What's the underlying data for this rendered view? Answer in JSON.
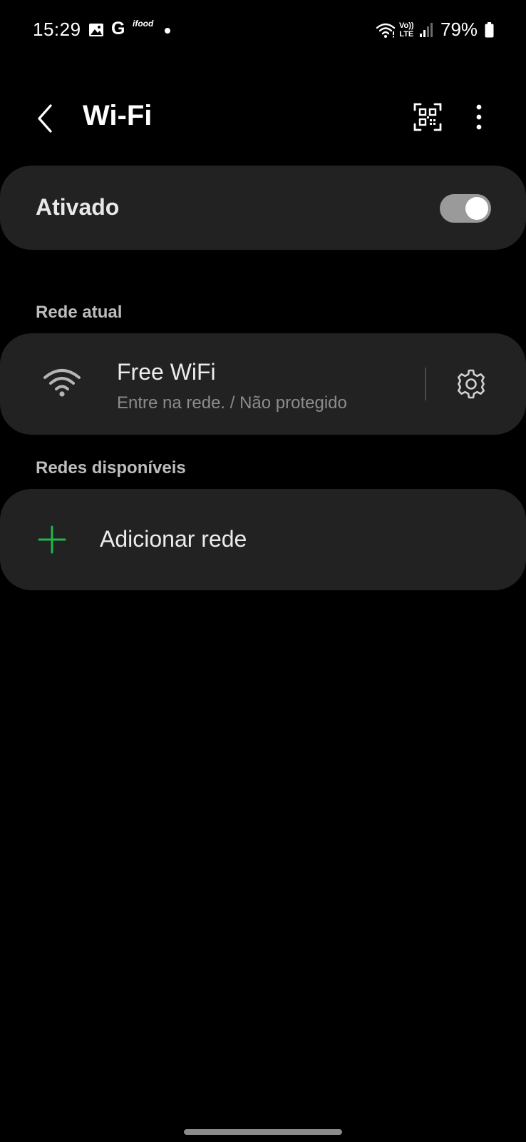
{
  "status_bar": {
    "time": "15:29",
    "g_label": "G",
    "ifood_label": "ifood",
    "volte_top": "Vo))",
    "volte_bottom": "LTE",
    "battery": "79%",
    "icons": [
      "gallery-icon",
      "google-icon",
      "ifood-icon",
      "dot-icon",
      "wifi-icon",
      "volte-icon",
      "signal-icon",
      "battery-icon"
    ]
  },
  "app_bar": {
    "title": "Wi-Fi",
    "back_icon": "chevron-left-icon",
    "qr_icon": "qr-code-scan-icon",
    "more_icon": "more-vertical-icon"
  },
  "wifi_toggle": {
    "label": "Ativado",
    "enabled": true
  },
  "current_network": {
    "section_title": "Rede atual",
    "name": "Free WiFi",
    "status": "Entre na rede. / Não protegido",
    "icon": "wifi-icon",
    "settings_icon": "gear-icon"
  },
  "available_networks": {
    "section_title": "Redes disponíveis",
    "add_label": "Adicionar rede",
    "add_icon": "plus-icon"
  },
  "colors": {
    "background": "#000000",
    "card": "#222222",
    "accent_green": "#1fb84a",
    "toggle_track": "#9a9a9a",
    "secondary_text": "#8c8c8c",
    "section_text": "#bdbdbd"
  }
}
